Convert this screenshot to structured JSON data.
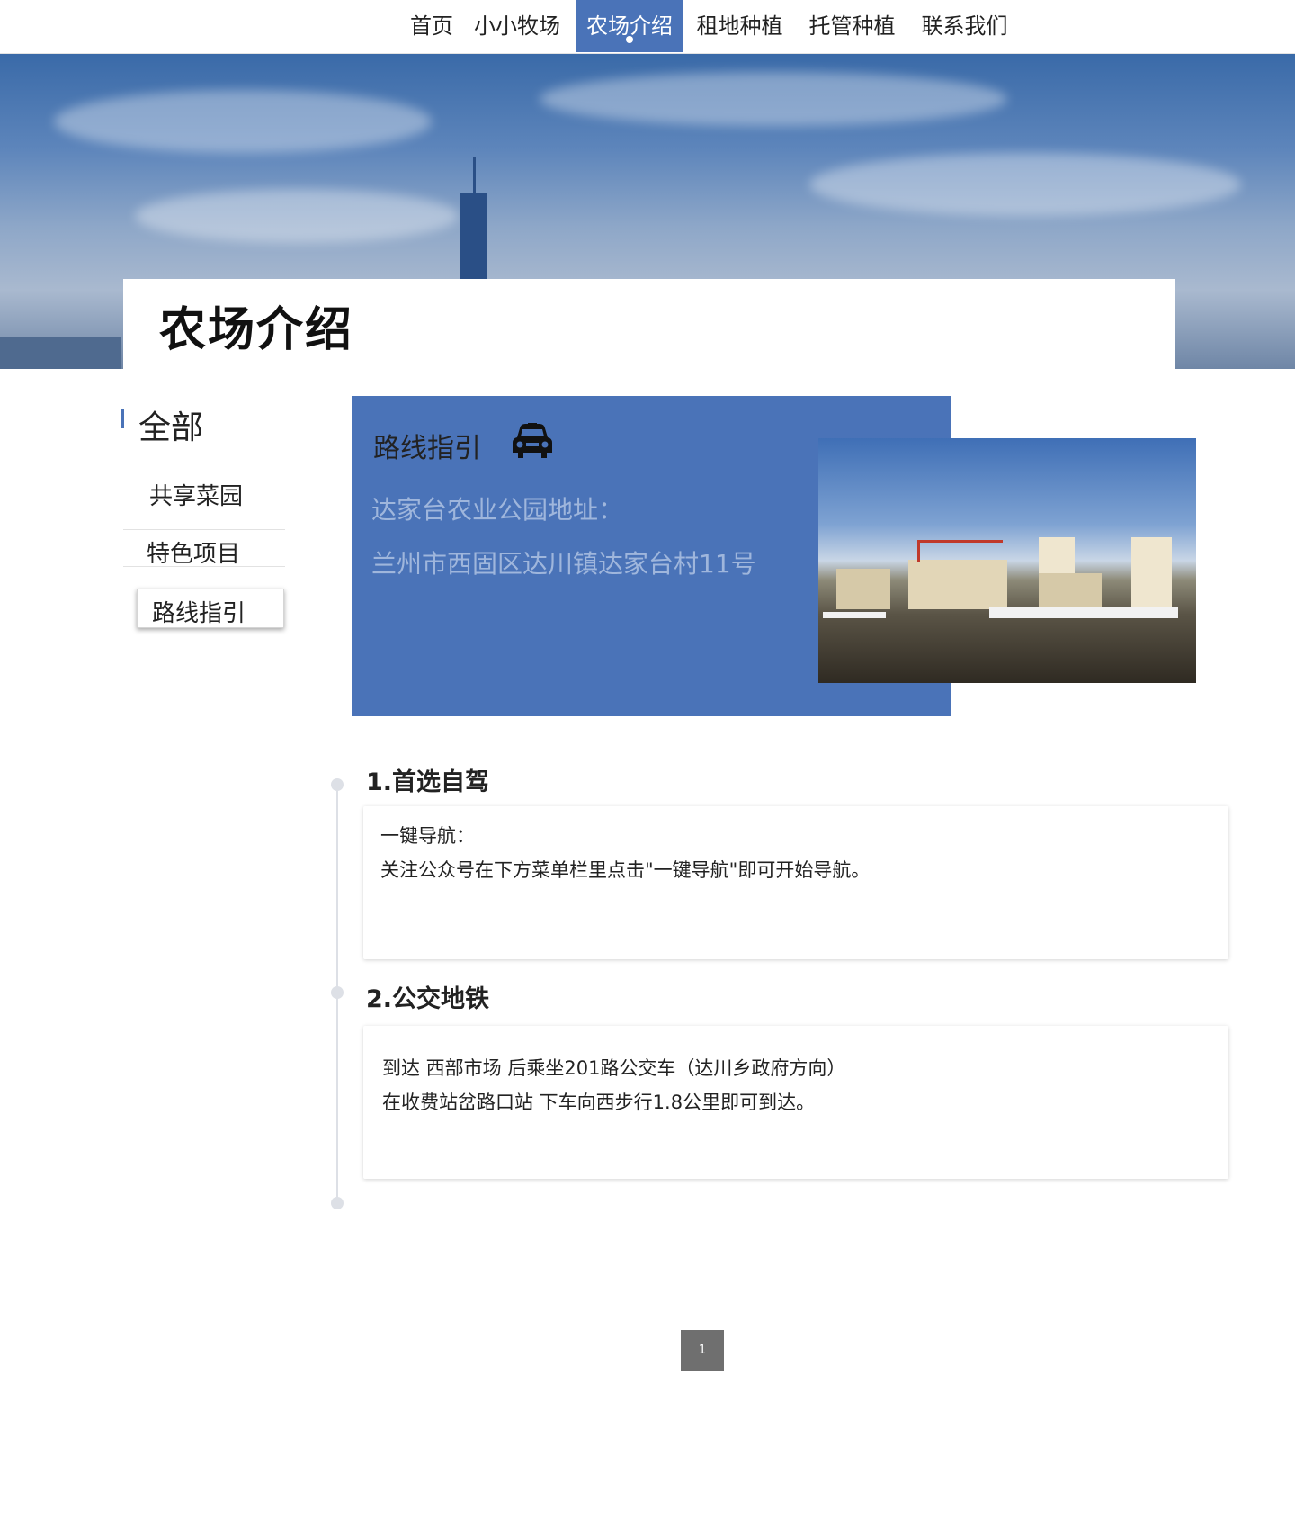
{
  "nav": {
    "items": [
      "首页",
      "小小牧场",
      "农场介绍",
      "租地种植",
      "托管种植",
      "联系我们"
    ],
    "active_index": 2,
    "accent_color": "#4a73b8"
  },
  "hero": {
    "title": "农场介绍"
  },
  "sidebar": {
    "heading": "全部",
    "items": [
      "共享菜园",
      "特色项目",
      "路线指引"
    ],
    "active_index": 2
  },
  "route": {
    "heading": "路线指引",
    "icon": "car-icon",
    "address_label": "达家台农业公园地址：",
    "address": "兰州市西固区达川镇达家台村11号"
  },
  "sections": [
    {
      "title": "1.首选自驾",
      "lines": [
        "一键导航：",
        "关注公众号在下方菜单栏里点击\"一键导航\"即可开始导航。"
      ]
    },
    {
      "title": "2.公交地铁",
      "lines": [
        "到达 西部市场 后乘坐201路公交车（达川乡政府方向）",
        "在收费站岔路口站 下车向西步行1.8公里即可到达。"
      ]
    }
  ],
  "pagination": {
    "current": "1"
  }
}
